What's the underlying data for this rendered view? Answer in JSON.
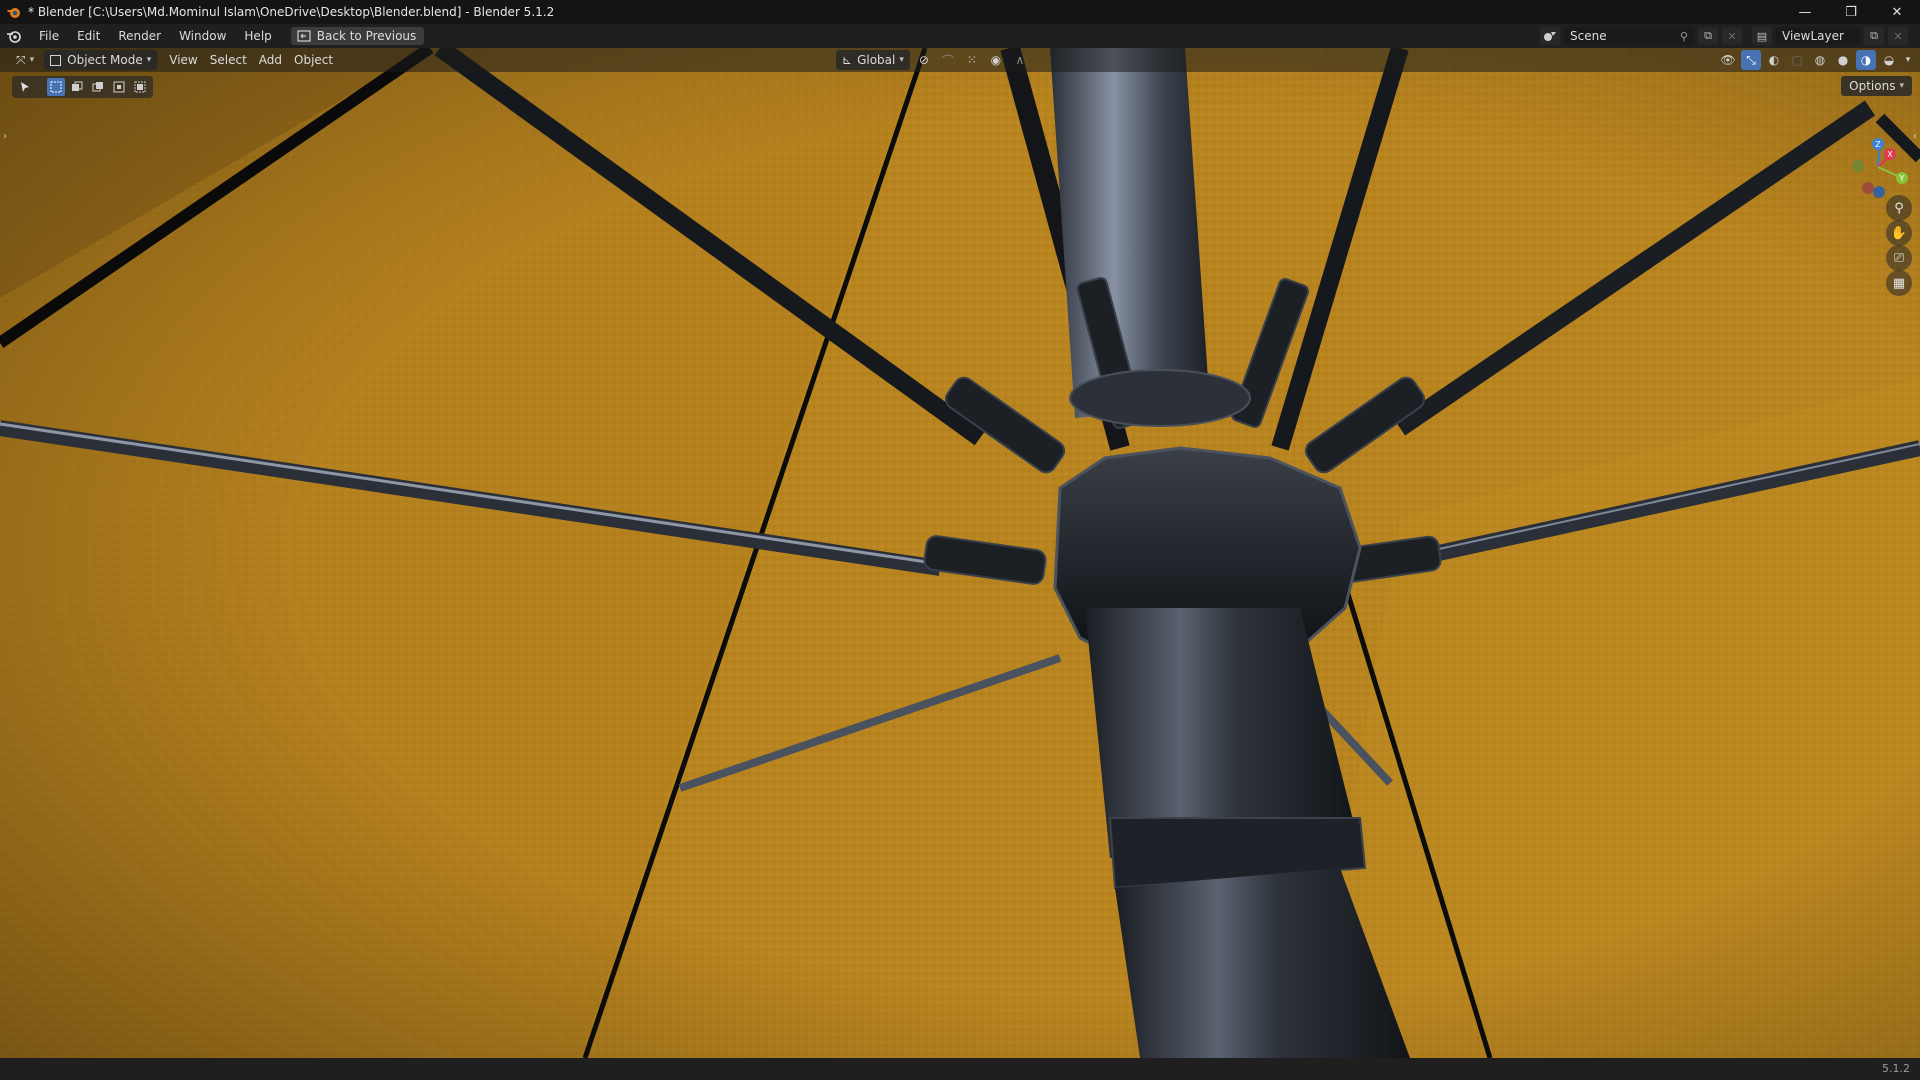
{
  "window": {
    "title": "* Blender [C:\\Users\\Md.Mominul Islam\\OneDrive\\Desktop\\Blender.blend] - Blender 5.1.2",
    "minimize_glyph": "—",
    "maximize_glyph": "❐",
    "close_glyph": "✕"
  },
  "menubar": {
    "items": [
      "File",
      "Edit",
      "Render",
      "Window",
      "Help"
    ],
    "back_button": "Back to Previous",
    "scene_name": "Scene",
    "view_layer_name": "ViewLayer"
  },
  "viewport_header": {
    "mode": "Object Mode",
    "menus": [
      "View",
      "Select",
      "Add",
      "Object"
    ],
    "transform_orientation": "Global",
    "shading_active": "solid"
  },
  "tool_settings": {
    "options_label": "Options"
  },
  "gizmo": {
    "axes": [
      "X",
      "Y",
      "Z"
    ],
    "colors": {
      "x": "#e0394d",
      "y": "#8ac43a",
      "z": "#3d7fd6"
    }
  },
  "statusbar": {
    "version": "5.1.2"
  },
  "colors": {
    "canopy": "#b88420",
    "accent": "#4772b3"
  }
}
